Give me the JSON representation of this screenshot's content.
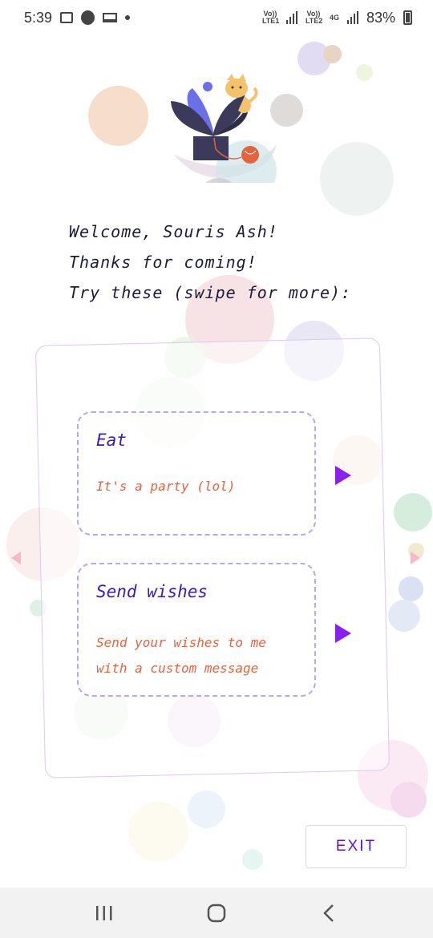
{
  "status_bar": {
    "time": "5:39",
    "network_1": "Vo)) LTE1",
    "network_2": "Vo)) LTE2",
    "network_type": "4G",
    "battery": "83%",
    "icons": [
      "image-icon",
      "drop-icon",
      "laptop-icon",
      "dot-icon",
      "signal-icon",
      "battery-icon"
    ]
  },
  "welcome": {
    "line1": "Welcome, Souris Ash!",
    "line2": "Thanks for coming!",
    "line3": "Try these (swipe for more):"
  },
  "options": [
    {
      "title": "Eat",
      "description": "It's a party (lol)"
    },
    {
      "title": "Send wishes",
      "description_line1": "Send your wishes to me",
      "description_line2": "with a custom message"
    }
  ],
  "exit_label": "EXIT",
  "nav": {
    "icons": [
      "recent-apps-icon",
      "home-icon",
      "back-icon"
    ]
  },
  "colors": {
    "accent": "#8a1ff0",
    "title": "#3a17c0",
    "description": "#e4633f",
    "exit_text": "#5a16c9"
  }
}
